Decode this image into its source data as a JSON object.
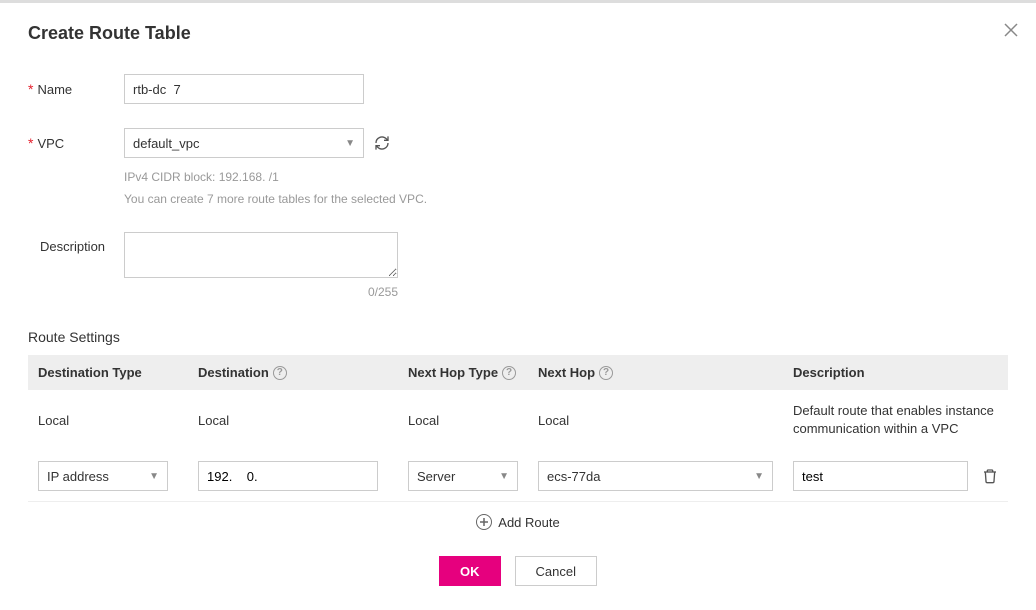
{
  "title": "Create Route Table",
  "form": {
    "name_label": "Name",
    "name_value": "rtb-dc  7",
    "vpc_label": "VPC",
    "vpc_value": "default_vpc",
    "cidr_text": "IPv4 CIDR block: 192.168.    /1",
    "tables_remaining_text": "You can create 7 more route tables for the selected VPC.",
    "description_label": "Description",
    "description_value": "",
    "char_count": "0/255"
  },
  "route_section_title": "Route Settings",
  "columns": {
    "destination_type": "Destination Type",
    "destination": "Destination",
    "next_hop_type": "Next Hop Type",
    "next_hop": "Next Hop",
    "description": "Description"
  },
  "default_route": {
    "destination_type": "Local",
    "destination": "Local",
    "next_hop_type": "Local",
    "next_hop": "Local",
    "description": "Default route that enables instance communication within a VPC"
  },
  "routes": [
    {
      "destination_type": "IP address",
      "destination": "192.    0.",
      "next_hop_type": "Server",
      "next_hop": "ecs-77da",
      "description": "test"
    }
  ],
  "add_route_label": "Add Route",
  "buttons": {
    "ok": "OK",
    "cancel": "Cancel"
  }
}
